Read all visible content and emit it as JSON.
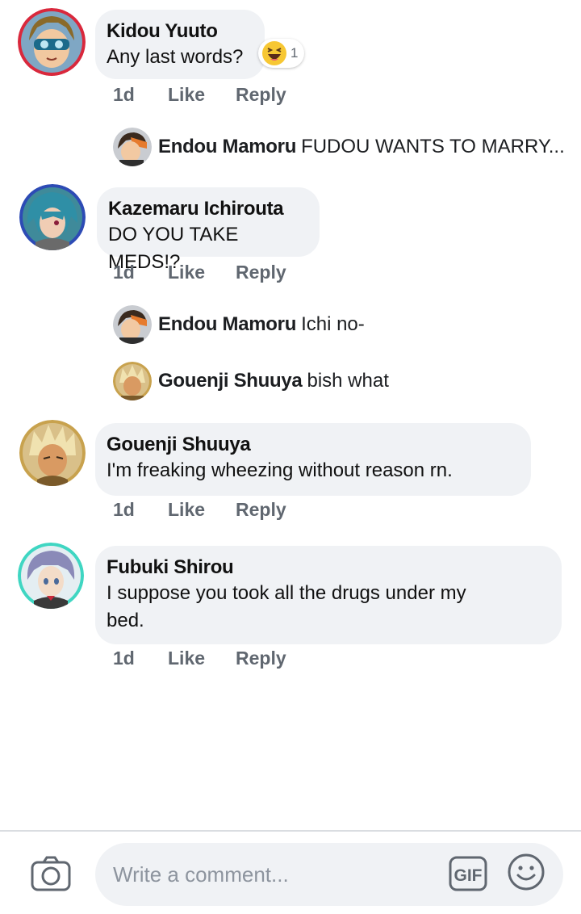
{
  "comments": [
    {
      "author": "Kidou Yuuto",
      "text": "Any last words?",
      "reaction": {
        "icon": "laughing-emoji-icon",
        "count": "1"
      },
      "time": "1d",
      "like": "Like",
      "reply": "Reply",
      "replies": [
        {
          "author": "Endou Mamoru",
          "text": "FUDOU WANTS TO MARRY..."
        }
      ]
    },
    {
      "author": "Kazemaru Ichirouta",
      "text": "DO YOU TAKE MEDS!?",
      "time": "1d",
      "like": "Like",
      "reply": "Reply",
      "replies": [
        {
          "author": "Endou Mamoru",
          "text": "Ichi no-"
        },
        {
          "author": "Gouenji Shuuya",
          "text": "bish what"
        }
      ]
    },
    {
      "author": "Gouenji Shuuya",
      "text": "I'm freaking wheezing without reason rn.",
      "time": "1d",
      "like": "Like",
      "reply": "Reply"
    },
    {
      "author": "Fubuki Shirou",
      "text_line1": "I suppose you took all the drugs under my",
      "text_line2": "bed.",
      "time": "1d",
      "like": "Like",
      "reply": "Reply"
    }
  ],
  "composer": {
    "placeholder": "Write a comment...",
    "gif_label": "GIF",
    "icons": [
      "camera-icon",
      "gif-icon",
      "smiley-icon"
    ]
  },
  "colors": {
    "bubble": "#f0f2f5",
    "action_text": "#606770",
    "kidou_ring": "#d9283c",
    "kazemaru_ring": "#2d4bb5",
    "gouenji_ring": "#c8a24e",
    "fubuki_ring": "#3fd6c2"
  }
}
